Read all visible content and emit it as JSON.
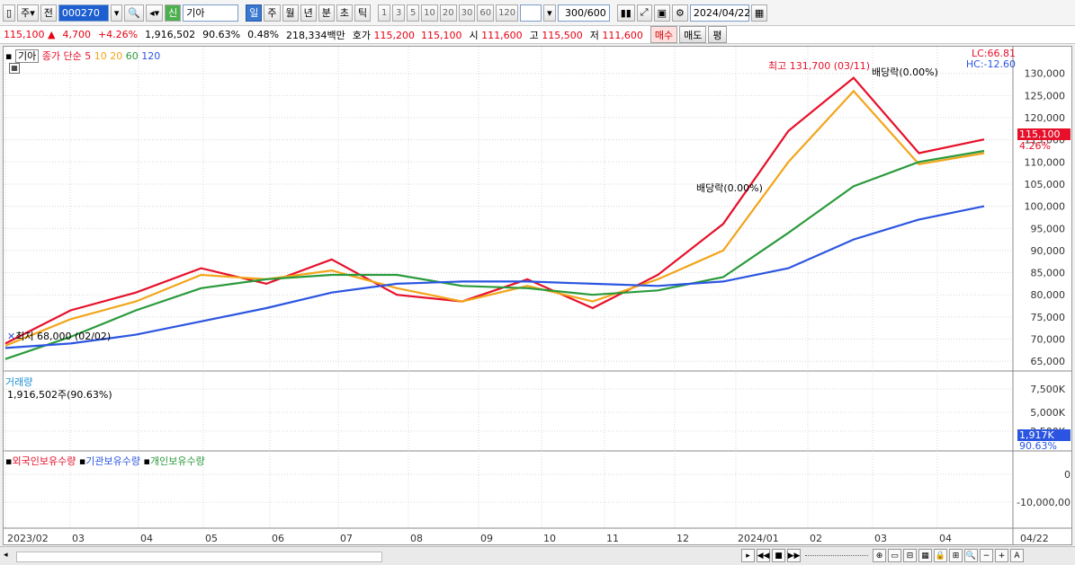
{
  "toolbar": {
    "market_label": "주",
    "prev_label": "전",
    "code_value": "000270",
    "stock_badge": "신",
    "stock_name": "기아",
    "period_tabs": [
      "일",
      "주",
      "월",
      "년",
      "분",
      "초",
      "틱"
    ],
    "active_period": "일",
    "interval_buttons": [
      "1",
      "3",
      "5",
      "10",
      "20",
      "30",
      "60",
      "120"
    ],
    "count_value": "300",
    "count_max": "/600",
    "date_value": "2024/04/22"
  },
  "quote": {
    "price": "115,100",
    "change": "4,700",
    "change_pct": "+4.26%",
    "volume": "1,916,502",
    "volume_ratio": "90.63%",
    "turnover": "0.48%",
    "amount": "218,334백만",
    "bid_label": "호가",
    "bid1": "115,200",
    "bid2": "115,100",
    "open_label": "시",
    "open": "111,600",
    "high_label": "고",
    "high": "115,500",
    "low_label": "저",
    "low": "111,600",
    "buy_label": "매수",
    "sell_label": "매도",
    "eval_label": "평"
  },
  "price_pane": {
    "stock": "기아",
    "ma_label": "종가 단순",
    "ma_periods": [
      "5",
      "10",
      "20",
      "60",
      "120"
    ],
    "ma_colors": [
      "#e6102a",
      "#f2a51a",
      "#f2a51a",
      "#2a9a3c",
      "#2b55e0"
    ],
    "lc_label": "LC:66.81",
    "hc_label": "HC:-12.60",
    "last_price_tag": "115,100",
    "last_pct_tag": "4.26%",
    "high_annotation": "최고 131,700 (03/11)",
    "low_annotation": "최저 68,000 (02/02)",
    "dividend_annotation_1": "배당락(0.00%)",
    "dividend_annotation_2": "배당락(0.00%)",
    "y_ticks": [
      "130,000",
      "125,000",
      "120,000",
      "115,000",
      "110,000",
      "105,000",
      "100,000",
      "95,000",
      "90,000",
      "85,000",
      "80,000",
      "75,000",
      "70,000",
      "65,000"
    ]
  },
  "volume_pane": {
    "title": "거래량",
    "value": "1,916,502주(90.63%)",
    "y_ticks": [
      "7,500K",
      "5,000K",
      "2,500K"
    ],
    "last_tag": "1,917K",
    "pct_tag": "90.63%"
  },
  "holdings_pane": {
    "series": [
      "외국인보유수량",
      "기관보유수량",
      "개인보유수량"
    ],
    "colors": [
      "#e6102a",
      "#2b55e0",
      "#2a9a3c"
    ],
    "y_ticks": [
      "0",
      "-10,000,00"
    ]
  },
  "x_axis": [
    "2023/02",
    "03",
    "04",
    "05",
    "06",
    "07",
    "08",
    "09",
    "10",
    "11",
    "12",
    "2024/01",
    "02",
    "03",
    "04"
  ],
  "x_axis_end": "04/22",
  "chart_data": {
    "type": "line",
    "title": "기아",
    "x": [
      "2023/02",
      "2023/03",
      "2023/04",
      "2023/05",
      "2023/06",
      "2023/07",
      "2023/08",
      "2023/09",
      "2023/10",
      "2023/11",
      "2023/12",
      "2024/01",
      "2024/02",
      "2024/03",
      "2024/04",
      "2024/04/22"
    ],
    "ylim": [
      63000,
      134000
    ],
    "series": [
      {
        "name": "5",
        "values": [
          69000,
          76500,
          80500,
          86000,
          82500,
          88000,
          80000,
          78500,
          83500,
          77000,
          84500,
          96000,
          117000,
          129000,
          112000,
          115100
        ]
      },
      {
        "name": "20",
        "values": [
          68500,
          74500,
          78500,
          84500,
          83500,
          85500,
          81500,
          78500,
          82000,
          78500,
          83500,
          90000,
          110000,
          126000,
          109500,
          112000
        ]
      },
      {
        "name": "60",
        "values": [
          65500,
          70500,
          76500,
          81500,
          83500,
          84500,
          84500,
          82000,
          81500,
          80000,
          81000,
          84000,
          94000,
          104500,
          110000,
          112500
        ]
      },
      {
        "name": "120",
        "values": [
          68000,
          69000,
          71000,
          74000,
          77000,
          80500,
          82500,
          83000,
          83000,
          82500,
          82000,
          83000,
          86000,
          92500,
          97000,
          100000
        ]
      }
    ],
    "high": {
      "value": 131700,
      "date": "03/11"
    },
    "low": {
      "value": 68000,
      "date": "02/02"
    },
    "last": 115100
  }
}
